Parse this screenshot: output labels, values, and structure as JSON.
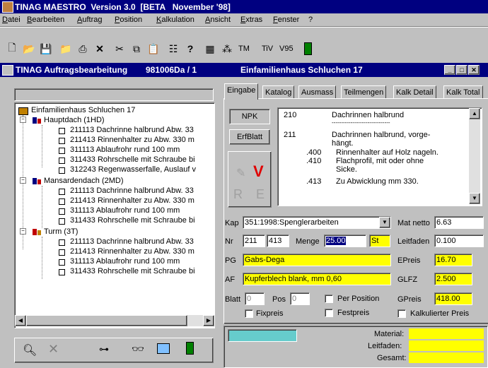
{
  "app": {
    "title": "TINAG MAESTRO  Version 3.0  [BETA   November '98]"
  },
  "menu": [
    "Datei",
    "Bearbeiten",
    "Auftrag",
    "Position",
    "Kalkulation",
    "Ansicht",
    "Extras",
    "Fenster",
    "?"
  ],
  "toolbar": {
    "tm": "TM",
    "tv": "TiV",
    "v95": "V95"
  },
  "child": {
    "title_left": "TINAG Auftragsbearbeitung",
    "title_mid": "981006Da / 1",
    "title_right": "Einfamilienhaus Schluchen 17"
  },
  "tree": {
    "root": "Einfamilienhaus Schluchen 17",
    "groups": [
      {
        "label": "Hauptdach (1HD)",
        "items": [
          "211113 Dachrinne halbrund Abw. 33",
          "211413 Rinnenhalter zu Abw. 330 m",
          "311113 Ablaufrohr rund 100 mm",
          "311433 Rohrschelle mit Schraube bi",
          "312243 Regenwasserfalle, Auslauf v"
        ]
      },
      {
        "label": "Mansardendach (2MD)",
        "items": [
          "211113 Dachrinne halbrund Abw. 33",
          "211413 Rinnenhalter zu Abw. 330 m",
          "311113 Ablaufrohr rund 100 mm",
          "311433 Rohrschelle mit Schraube bi"
        ]
      },
      {
        "label": "Turm (3T)",
        "items": [
          "211113 Dachrinne halbrund Abw. 33",
          "211413 Rinnenhalter zu Abw. 330 m",
          "311113 Ablaufrohr rund 100 mm",
          "311433 Rohrschelle mit Schraube bi"
        ]
      }
    ]
  },
  "tabs": [
    "Eingabe",
    "Katalog",
    "Ausmass",
    "Teilmengen",
    "Kalk Detail",
    "Kalk Total"
  ],
  "buttons": {
    "npk": "NPK",
    "erfblatt": "ErfBlatt",
    "r": "R",
    "e": "E",
    "v": "V"
  },
  "text_lines": [
    {
      "num": "210",
      "text": "Dachrinnen halbrund"
    },
    {
      "num": "",
      "text": "-------------------------------"
    },
    {
      "num": "211",
      "text": "Dachrinnen halbrund, vorge-"
    },
    {
      "num": "",
      "text": "hängt."
    },
    {
      "num": ".400",
      "text": "Rinnenhalter auf Holz nageln."
    },
    {
      "num": ".410",
      "text": "Flachprofil, mit oder ohne"
    },
    {
      "num": "",
      "text": "Sicke."
    },
    {
      "num": ".413",
      "text": "Zu Abwicklung mm 330."
    }
  ],
  "form": {
    "kap_label": "Kap",
    "kap_value": "351:1998:Spenglerarbeiten",
    "nr_label": "Nr",
    "nr1": "211",
    "nr2": "413",
    "menge_label": "Menge",
    "menge_value": "25.00",
    "unit": "St",
    "pg_label": "PG",
    "pg_value": "Gabs-Dega",
    "af_label": "AF",
    "af_value": "Kupferblech blank, mm 0,60",
    "blatt_label": "Blatt",
    "blatt_value": "0",
    "pos_label": "Pos",
    "pos_value": "0",
    "per_position": "Per Position",
    "fixpreis": "Fixpreis",
    "festpreis": "Festpreis",
    "kalk_preis": "Kalkulierter Preis",
    "mat_netto_label": "Mat netto",
    "mat_netto": "6.63",
    "leitfaden_label": "Leitfaden",
    "leitfaden": "0.100",
    "epreis_label": "EPreis",
    "epreis": "16.70",
    "glfz_label": "GLFZ",
    "glfz": "2.500",
    "gpreis_label": "GPreis",
    "gpreis": "418.00"
  },
  "totals": {
    "material": "Material:",
    "leitfaden": "Leitfaden:",
    "gesamt": "Gesamt:"
  },
  "colors": {
    "titlebar": "#000080",
    "highlight": "#ffff00",
    "cyan": "#66cccc"
  }
}
